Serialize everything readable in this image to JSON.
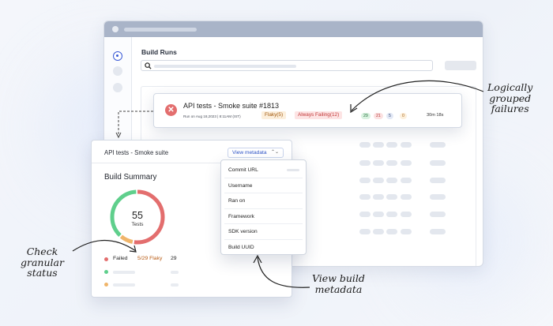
{
  "app": {
    "page_title": "Build Runs"
  },
  "run": {
    "title": "API tests - Smoke suite #1813",
    "meta": "Run on Aug 18,2023 | 8:11AM (IST)",
    "tag_flaky": "Flaky(5)",
    "tag_failing": "Always Failing(12)",
    "count_pass": "29",
    "count_fail": "21",
    "count_flaky": "5",
    "count_skip": "0",
    "duration": "30m 18s",
    "status_icon": "error-x-icon"
  },
  "summary": {
    "suite_name": "API tests - Smoke suite",
    "metadata_button": "View metadata",
    "title": "Build Summary",
    "total": "55",
    "total_label": "Tests",
    "legend_failed": "Failed",
    "legend_flaky": "5/29 Flaky",
    "legend_count": "29",
    "donut_fractions": {
      "failed": 0.53,
      "flaky": 0.09,
      "passed": 0.38
    }
  },
  "metadata_menu": {
    "items": [
      "Commit URL",
      "Username",
      "Ran on",
      "Framework",
      "SDK version",
      "Build UUID"
    ]
  },
  "annotations": {
    "grouped_line1": "Logically",
    "grouped_line2": "grouped",
    "grouped_line3": "failures",
    "status_line1": "Check",
    "status_line2": "granular",
    "status_line3": "status",
    "metadata_line1": "View build",
    "metadata_line2": "metadata"
  },
  "colors": {
    "failed": "#e36e6e",
    "flaky": "#f0b56a",
    "passed": "#5fcf8c",
    "accent": "#2e54c7"
  }
}
